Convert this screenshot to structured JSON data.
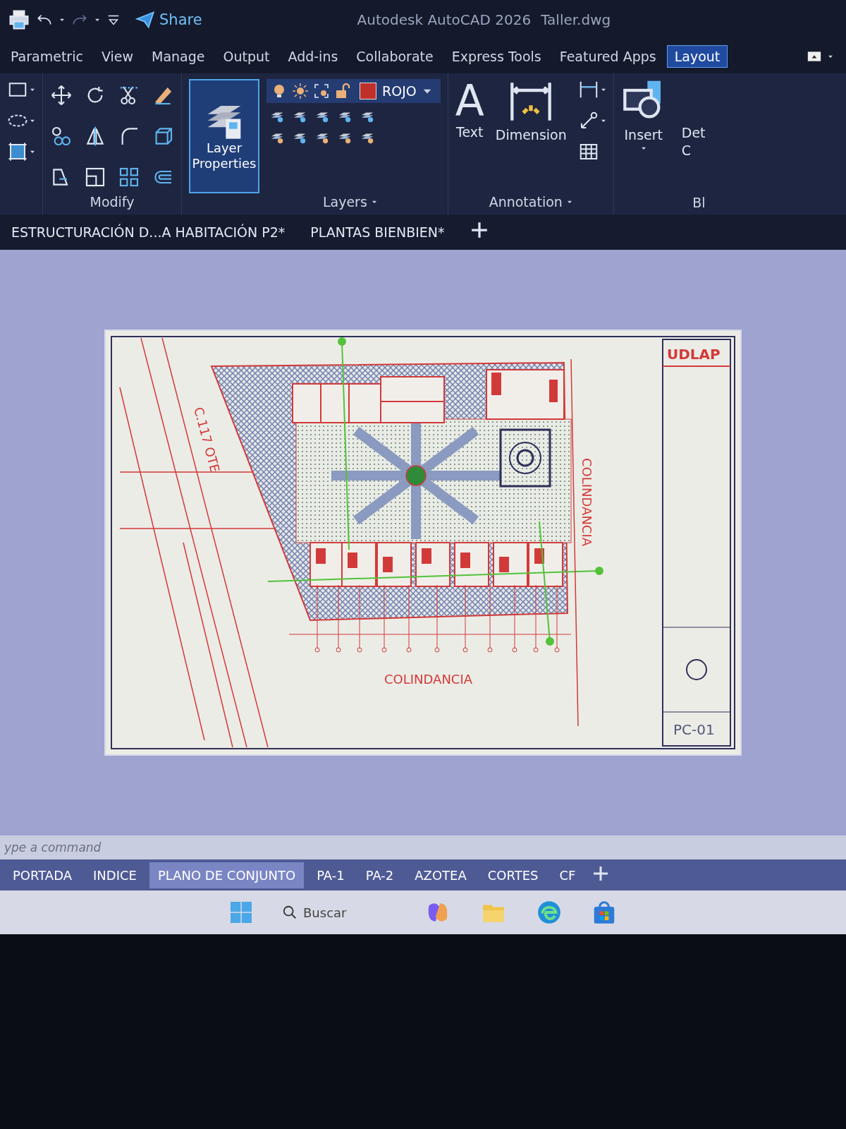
{
  "title_bar": {
    "share": "Share",
    "app_name": "Autodesk AutoCAD 2026",
    "file_name": "Taller.dwg"
  },
  "ribbon_tabs": [
    {
      "label": "Parametric",
      "selected": false
    },
    {
      "label": "View",
      "selected": false
    },
    {
      "label": "Manage",
      "selected": false
    },
    {
      "label": "Output",
      "selected": false
    },
    {
      "label": "Add-ins",
      "selected": false
    },
    {
      "label": "Collaborate",
      "selected": false
    },
    {
      "label": "Express Tools",
      "selected": false
    },
    {
      "label": "Featured Apps",
      "selected": false
    },
    {
      "label": "Layout",
      "selected": true
    }
  ],
  "ribbon": {
    "modify": {
      "title": "Modify"
    },
    "layers": {
      "properties_button": "Layer Properties",
      "current_layer": "ROJO",
      "color": "#c0302a",
      "title": "Layers"
    },
    "annotation": {
      "text_icon": "A",
      "text_tool": "Text",
      "dimension_tool": "Dimension",
      "title": "Annotation"
    },
    "block": {
      "insert_tool": "Insert",
      "cut_tool_line_1": "Det",
      "cut_tool_line_2": "C",
      "cut_title": "Bl"
    }
  },
  "file_tabs": [
    {
      "label": "ESTRUCTURACIÓN D...A HABITACIÓN P2*"
    },
    {
      "label": "PLANTAS BIENBIEN*"
    }
  ],
  "drawing": {
    "street_label": "C.117 OTE",
    "east_label": "COLINDANCIA",
    "south_label": "COLINDANCIA",
    "logo": "UDLAP",
    "sheet_number": "PC-01"
  },
  "command_line": {
    "placeholder": "ype a command"
  },
  "layout_tabs": [
    {
      "label": "PORTADA",
      "selected": false
    },
    {
      "label": "INDICE",
      "selected": false
    },
    {
      "label": "PLANO DE CONJUNTO",
      "selected": true
    },
    {
      "label": "PA-1",
      "selected": false
    },
    {
      "label": "PA-2",
      "selected": false
    },
    {
      "label": "AZOTEA",
      "selected": false
    },
    {
      "label": "CORTES",
      "selected": false
    },
    {
      "label": "CF",
      "selected": false
    }
  ],
  "taskbar": {
    "search_placeholder": "Buscar"
  }
}
